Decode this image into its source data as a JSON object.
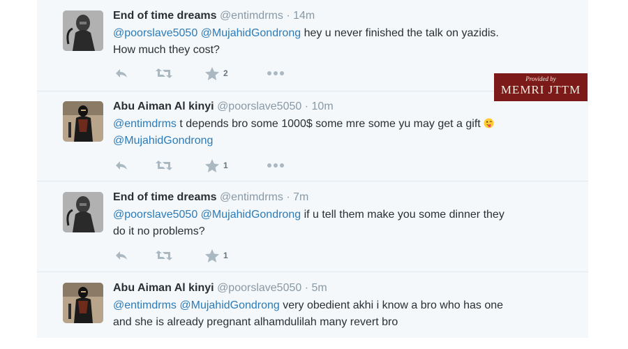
{
  "tweets": [
    {
      "name": "End of time dreams",
      "handle": "@entimdrms",
      "separator": "·",
      "time": "14m",
      "mentions": [
        "@poorslave5050",
        "@MujahidGondrong"
      ],
      "text": "hey u never finished the talk on yazidis.",
      "text2": "How much they cost?",
      "favorites": "2",
      "avatar": "helmeted-warrior-avatar"
    },
    {
      "name": "Abu Aiman Al kinyi",
      "handle": "@poorslave5050",
      "separator": "·",
      "time": "10m",
      "mention1": "@entimdrms",
      "text": "t depends bro some 1000$ some mre some yu may get a gift",
      "emoji": "tongue-wink-emoji",
      "mention2": "@MujahidGondrong",
      "favorites": "1",
      "avatar": "masked-fighter-avatar"
    },
    {
      "name": "End of time dreams",
      "handle": "@entimdrms",
      "separator": "·",
      "time": "7m",
      "mentions": [
        "@poorslave5050",
        "@MujahidGondrong"
      ],
      "text": "if u tell them make you some dinner they",
      "text2": "do it no problems?",
      "favorites": "1",
      "avatar": "helmeted-warrior-avatar"
    },
    {
      "name": "Abu Aiman Al kinyi",
      "handle": "@poorslave5050",
      "separator": "·",
      "time": "5m",
      "mentions": [
        "@entimdrms",
        "@MujahidGondrong"
      ],
      "text": "very obedient akhi i know a bro who has one",
      "text2": "and she is already pregnant alhamdulilah many revert bro",
      "avatar": "masked-fighter-avatar"
    }
  ],
  "watermark": {
    "line1": "Provided by",
    "line2": "MEMRI JTTM"
  },
  "icons": {
    "reply": "reply-icon",
    "retweet": "retweet-icon",
    "favorite": "star-icon",
    "more": "more-icon"
  },
  "colors": {
    "link": "#2b7bb9",
    "name": "#292f33",
    "meta": "#8899a6",
    "action": "#aab8c2",
    "panel_bg": "#f5f8fa",
    "watermark_bg": "#7c1a1a"
  }
}
